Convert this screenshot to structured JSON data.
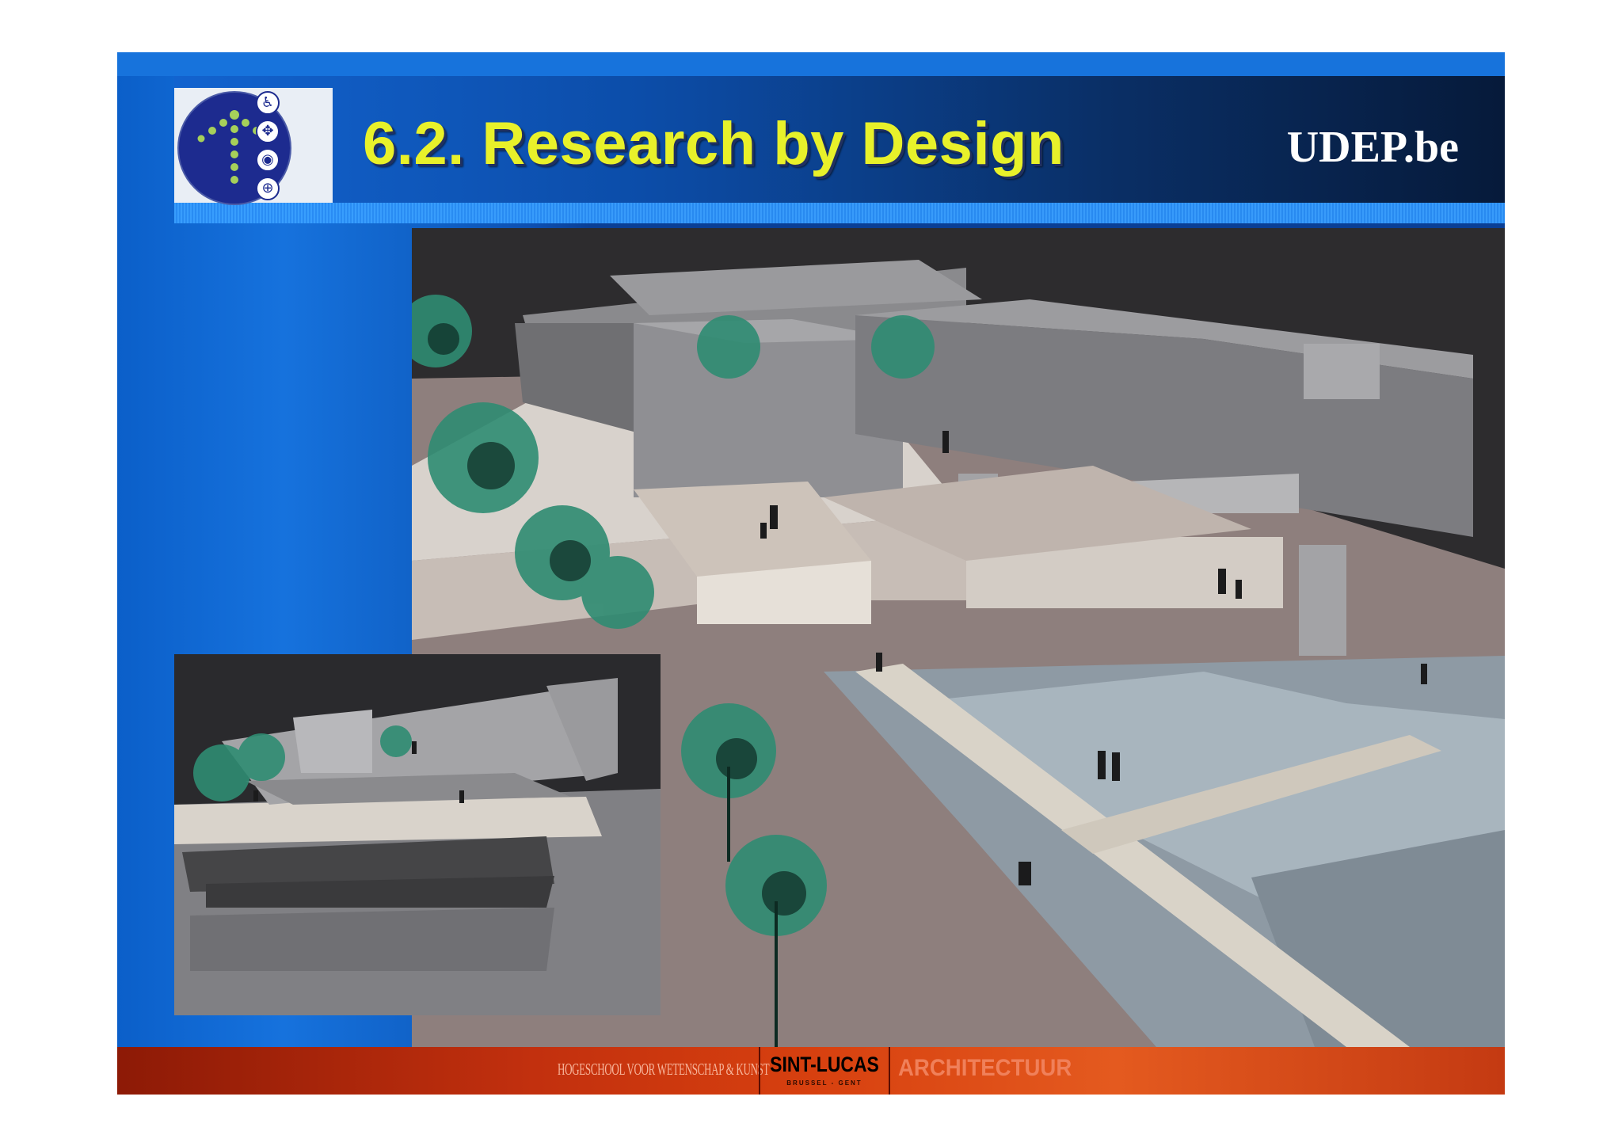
{
  "header": {
    "title": "6.2. Research by Design",
    "brand": "UDEP.be"
  },
  "logo": {
    "icons": [
      "wheelchair-icon",
      "compass-icon",
      "eye-icon",
      "globe-icon"
    ],
    "accent": "#e8f12a",
    "circle_color": "#1d2b8f"
  },
  "footer": {
    "institution": "HOGESCHOOL VOOR WETENSCHAP & KUNST",
    "school": "SINT-LUCAS",
    "location": "BRUSSEL - GENT",
    "department": "ARCHITECTUUR"
  },
  "colors": {
    "title_yellow": "#e8f12a",
    "slide_blue": "#0b5fc9",
    "footer_red": "#c2300e"
  }
}
